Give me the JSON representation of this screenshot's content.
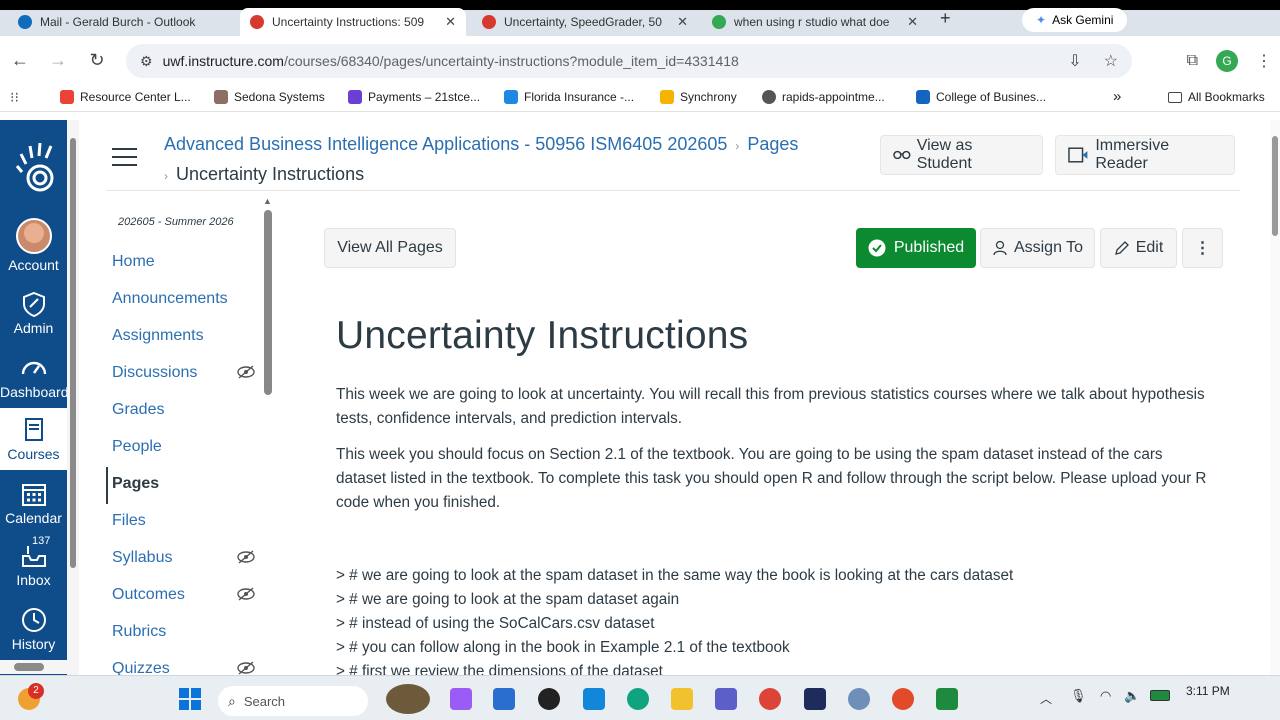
{
  "browser": {
    "tabs": [
      {
        "title": "Mail - Gerald Burch - Outlook",
        "color": "#0f6cbd"
      },
      {
        "title": "Uncertainty Instructions: 509",
        "color": "#d63a2e"
      },
      {
        "title": "Uncertainty, SpeedGrader, 50",
        "color": "#d63a2e"
      },
      {
        "title": "when using r studio what doe",
        "color": "#34a853"
      }
    ],
    "new_tab": "+",
    "gemini_label": "Ask Gemini",
    "url_host": "uwf.instructure.com",
    "url_path": "/courses/68340/pages/uncertainty-instructions?module_item_id=4331418",
    "profile_initial": "G",
    "bookmarks": [
      {
        "label": "Resource Center L...",
        "color": "#ea4335"
      },
      {
        "label": "Sedona Systems",
        "color": "#8d6e63"
      },
      {
        "label": "Payments – 21stce...",
        "color": "#6b3fd4"
      },
      {
        "label": "Florida Insurance -...",
        "color": "#1e88e5"
      },
      {
        "label": "Synchrony",
        "color": "#f4b400"
      },
      {
        "label": "rapids-appointme...",
        "color": "#555555"
      },
      {
        "label": "College of Busines...",
        "color": "#1565c0"
      }
    ],
    "bookmarks_more": "»",
    "all_bookmarks": "All Bookmarks"
  },
  "global_nav": {
    "items": [
      {
        "label": "Account",
        "icon": "avatar"
      },
      {
        "label": "Admin",
        "icon": "shield-icon"
      },
      {
        "label": "Dashboard",
        "icon": "dashboard-icon"
      },
      {
        "label": "Courses",
        "icon": "courses-icon"
      },
      {
        "label": "Calendar",
        "icon": "calendar-icon"
      },
      {
        "label": "Inbox",
        "icon": "inbox-icon",
        "badge": "137"
      },
      {
        "label": "History",
        "icon": "history-icon"
      }
    ],
    "bg_color": "#0f4c8a"
  },
  "header": {
    "course_link": "Advanced Business Intelligence Applications - 50956 ISM6405 202605",
    "section_link": "Pages",
    "page_crumb": "Uncertainty Instructions",
    "view_as_student": "View as Student",
    "immersive_reader": "Immersive Reader"
  },
  "course_nav": {
    "term": "202605 - Summer 2026",
    "items": [
      {
        "label": "Home",
        "hidden": false
      },
      {
        "label": "Announcements",
        "hidden": false
      },
      {
        "label": "Assignments",
        "hidden": false
      },
      {
        "label": "Discussions",
        "hidden": true
      },
      {
        "label": "Grades",
        "hidden": false
      },
      {
        "label": "People",
        "hidden": false
      },
      {
        "label": "Pages",
        "hidden": false,
        "active": true
      },
      {
        "label": "Files",
        "hidden": false
      },
      {
        "label": "Syllabus",
        "hidden": true
      },
      {
        "label": "Outcomes",
        "hidden": true
      },
      {
        "label": "Rubrics",
        "hidden": false
      },
      {
        "label": "Quizzes",
        "hidden": true
      }
    ]
  },
  "page": {
    "view_all_pages": "View All Pages",
    "published": "Published",
    "assign_to": "Assign To",
    "edit": "Edit",
    "title": "Uncertainty Instructions",
    "para1": "This week we are going to look at uncertainty.  You will recall this from previous statistics courses where we talk about hypothesis tests, confidence intervals, and prediction intervals.",
    "para2": "This week you should focus on Section 2.1 of the textbook.  You are going to be using the spam dataset instead of the cars dataset listed in the textbook.  To complete this task you should open R and follow through the script below.  Please upload your R code when you finished.",
    "code_lines": [
      "> # we are going to look at the spam dataset in the same way the book is looking at the cars dataset",
      "> # we are going to look at the spam dataset again",
      "> # instead of using the SoCalCars.csv dataset",
      "> # you can follow along in the book in Example 2.1 of the textbook",
      "> # first we review the dimensions of the dataset"
    ],
    "published_color": "#0b8a2f"
  },
  "taskbar": {
    "search_placeholder": "Search",
    "time": "3:11 PM",
    "weather_badge": "2"
  }
}
